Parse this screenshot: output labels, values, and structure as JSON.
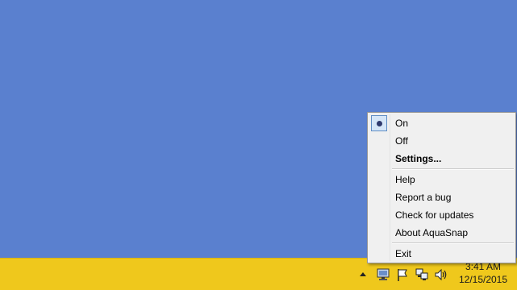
{
  "menu": {
    "items": [
      {
        "label": "On",
        "checked": true
      },
      {
        "label": "Off"
      },
      {
        "label": "Settings...",
        "bold": true
      },
      {
        "label": "Help"
      },
      {
        "label": "Report a bug"
      },
      {
        "label": "Check for updates"
      },
      {
        "label": "About AquaSnap"
      },
      {
        "label": "Exit"
      }
    ]
  },
  "taskbar": {
    "tray_icons": [
      "chevron-up-icon",
      "monitor-icon",
      "flag-icon",
      "network-icon",
      "speaker-icon"
    ],
    "clock": {
      "time": "3:41 AM",
      "date": "12/15/2015"
    }
  },
  "colors": {
    "desktop": "#5a80cf",
    "taskbar": "#efc81c",
    "menu_background": "#f0f0f0"
  }
}
